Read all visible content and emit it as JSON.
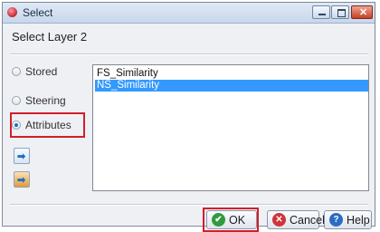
{
  "window": {
    "title": "Select"
  },
  "heading": "Select Layer 2",
  "radios": {
    "stored": "Stored",
    "steering": "Steering",
    "attributes": "Attributes",
    "selected": "attributes"
  },
  "list": {
    "items": [
      "FS_Similarity",
      "NS_Similarity"
    ],
    "selected_index": 1
  },
  "buttons": {
    "ok": "OK",
    "cancel": "Cancel",
    "help": "Help"
  },
  "icons": {
    "app": "app-icon",
    "side1": "move-right-icon",
    "side2": "import-icon"
  },
  "colors": {
    "highlight": "#d21e2b",
    "selection": "#3399ff"
  }
}
